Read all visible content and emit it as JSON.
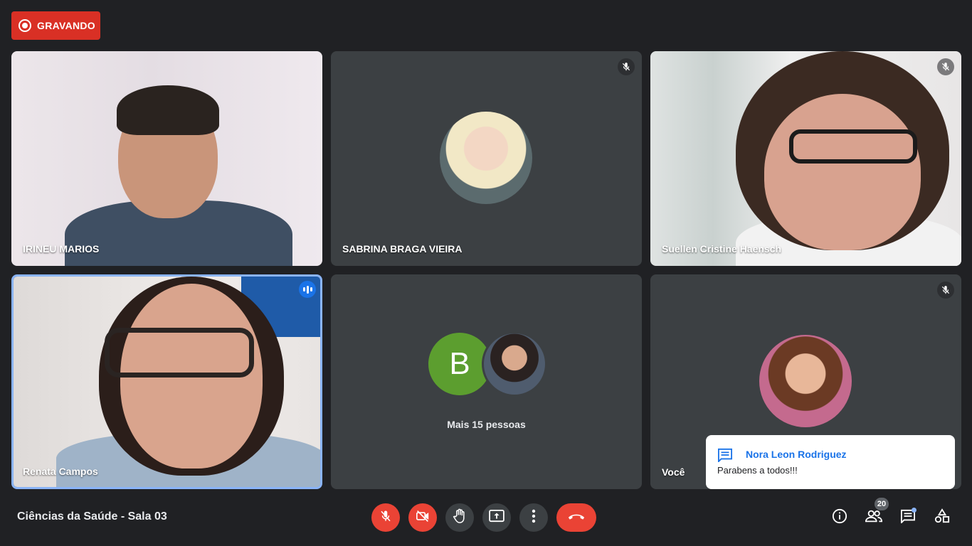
{
  "recording": {
    "label": "GRAVANDO"
  },
  "tiles": [
    {
      "name": "IRINEU MARIOS",
      "type": "video",
      "mic_muted": false
    },
    {
      "name": "SABRINA BRAGA VIEIRA",
      "type": "avatar",
      "mic_muted": true
    },
    {
      "name": "Suellen Cristine Haensch",
      "type": "video",
      "mic_muted": true
    },
    {
      "name": "Renata Campos",
      "type": "video",
      "speaking": true
    },
    {
      "name": "",
      "type": "group",
      "avatar_letter": "B",
      "more_text": "Mais 15 pessoas"
    },
    {
      "name": "Você",
      "type": "avatar",
      "mic_muted": true
    }
  ],
  "toast": {
    "sender": "Nora Leon Rodriguez",
    "message": "Parabens a todos!!!",
    "icon": "chat-icon"
  },
  "meeting": {
    "title": "Ciências da Saúde - Sala 03"
  },
  "controls": [
    {
      "name": "mic-off-icon",
      "state": "off"
    },
    {
      "name": "camera-off-icon",
      "state": "off"
    },
    {
      "name": "raise-hand-icon"
    },
    {
      "name": "present-icon"
    },
    {
      "name": "more-options-icon"
    },
    {
      "name": "leave-call-icon"
    }
  ],
  "right_controls": {
    "people_count": "20",
    "icons": [
      "info-icon",
      "people-icon",
      "chat-icon",
      "activities-icon"
    ]
  },
  "colors": {
    "background": "#202124",
    "tile": "#3c4043",
    "record_red": "#d93025",
    "speaking_blue": "#1a73e8",
    "active_border": "#8ab4f8"
  }
}
